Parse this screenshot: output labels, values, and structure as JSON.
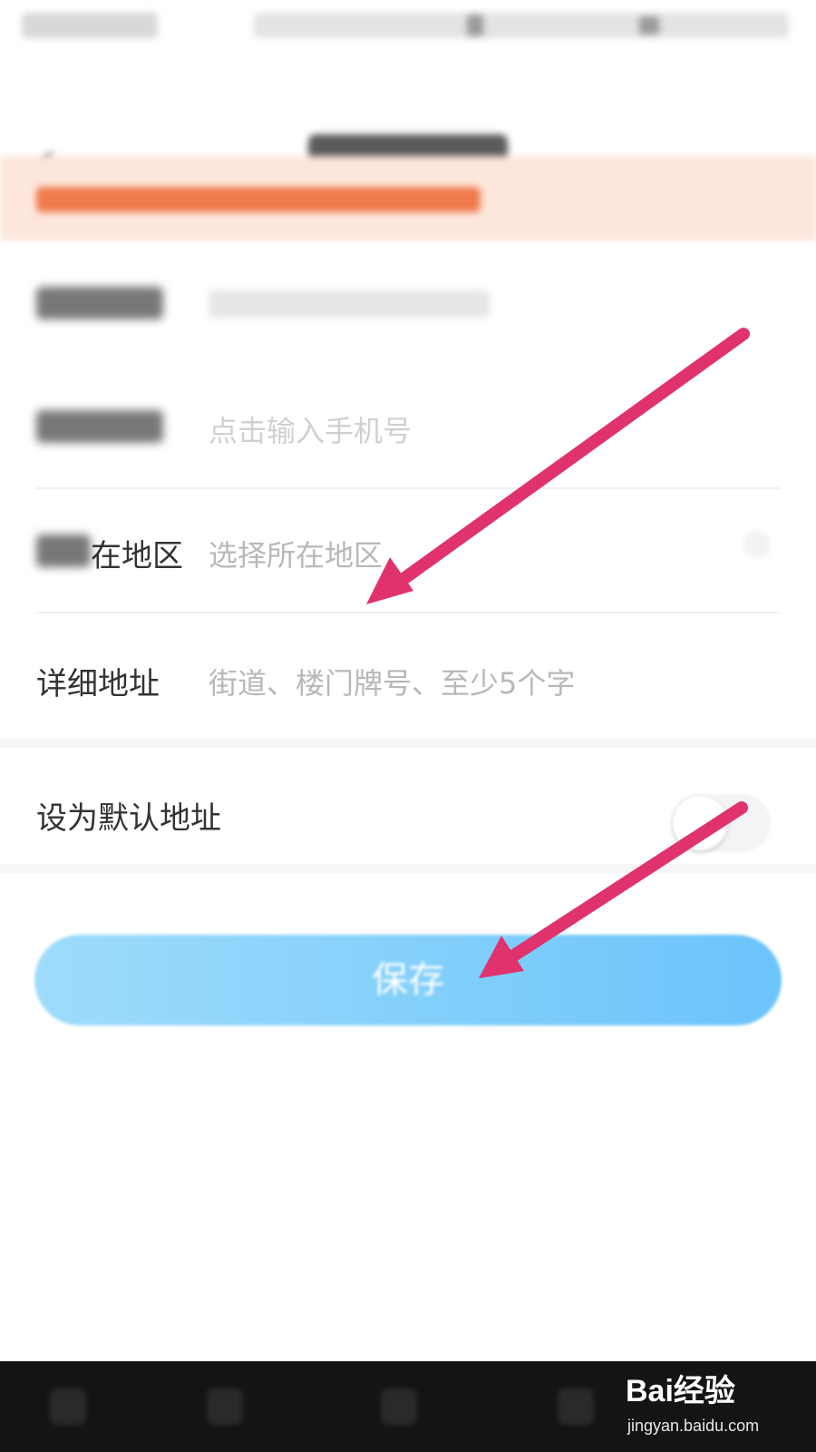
{
  "form": {
    "phone": {
      "placeholder": "点击输入手机号"
    },
    "region": {
      "label_visible": "在地区",
      "placeholder": "选择所在地区"
    },
    "address": {
      "label_visible": "详细地址",
      "placeholder": "街道、楼门牌号、至少5个字"
    },
    "default_address": {
      "label": "设为默认地址",
      "enabled": false
    }
  },
  "save_button": {
    "label": "保存"
  },
  "watermark": {
    "brand": "Bai经验",
    "domain": "jingyan.baidu.com"
  },
  "colors": {
    "save_button": "#84d0fb",
    "notice_background": "#fde6dc",
    "notice_text": "#ef7a4a",
    "annotation_arrow": "#e0336e"
  }
}
